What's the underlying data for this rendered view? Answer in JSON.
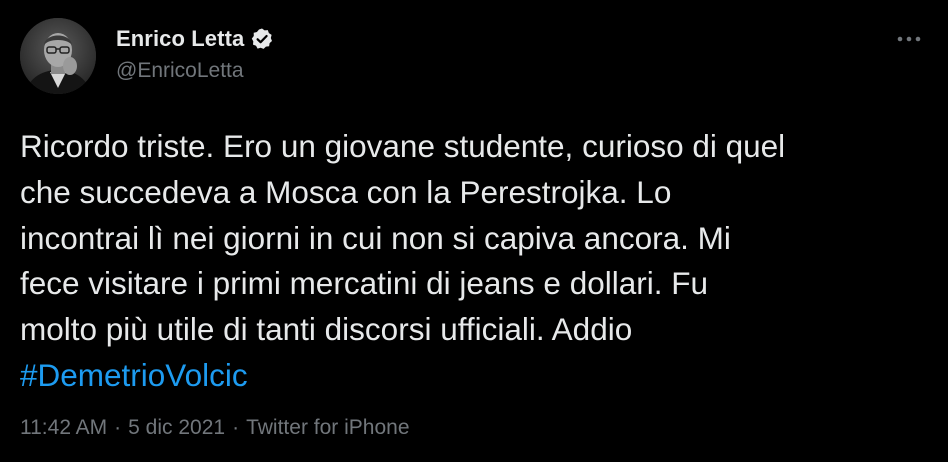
{
  "author": {
    "display_name": "Enrico Letta",
    "handle": "@EnricoLetta",
    "verified_icon": "verified-badge-icon"
  },
  "tweet": {
    "text_lines": [
      "Ricordo triste. Ero un giovane studente, curioso di quel",
      "che succedeva a Mosca con la Perestrojka. Lo",
      "incontrai lì nei giorni in cui non si capiva ancora. Mi",
      "fece visitare i primi mercatini di jeans e dollari. Fu",
      "molto più utile di tanti discorsi ufficiali. Addio"
    ],
    "hashtag": "#DemetrioVolcic"
  },
  "meta": {
    "time": "11:42 AM",
    "separator": "·",
    "date": "5 dic 2021",
    "source": "Twitter for iPhone"
  },
  "colors": {
    "background": "#000000",
    "text": "#e7e9ea",
    "secondary_text": "#71767b",
    "link": "#1d9bf0"
  },
  "icons": {
    "more": "more-dots-icon",
    "avatar": "profile-photo"
  }
}
